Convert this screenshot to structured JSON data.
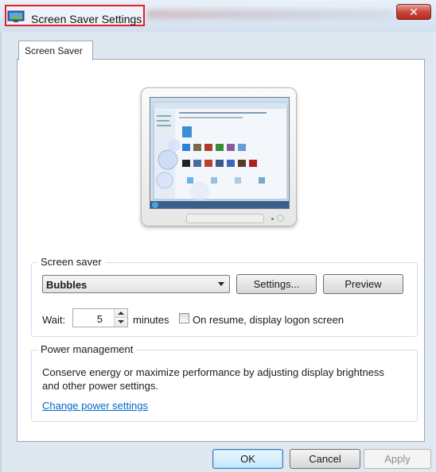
{
  "window": {
    "title": "Screen Saver Settings",
    "close_glyph": "✕"
  },
  "tabs": [
    {
      "label": "Screen Saver",
      "selected": true
    }
  ],
  "screen_saver_group": {
    "legend": "Screen saver",
    "selected_saver": "Bubbles",
    "settings_button": "Settings...",
    "preview_button": "Preview",
    "wait_label": "Wait:",
    "wait_value": "5",
    "minutes_label": "minutes",
    "resume_checkbox_label": "On resume, display logon screen",
    "resume_checked": false
  },
  "power_group": {
    "legend": "Power management",
    "description": "Conserve energy or maximize performance by adjusting display brightness and other power settings.",
    "link": "Change power settings"
  },
  "footer": {
    "ok_button": "OK",
    "cancel_button": "Cancel",
    "apply_button": "Apply",
    "apply_enabled": false
  },
  "colors": {
    "accent_highlight": "#e0202a",
    "link": "#0066cc",
    "close_button": "#c9473a"
  },
  "icons": {
    "app_icon": "display-properties-icon",
    "close": "close-icon",
    "combo_arrow": "chevron-down-icon",
    "spin_up": "arrow-up-icon",
    "spin_down": "arrow-down-icon"
  }
}
